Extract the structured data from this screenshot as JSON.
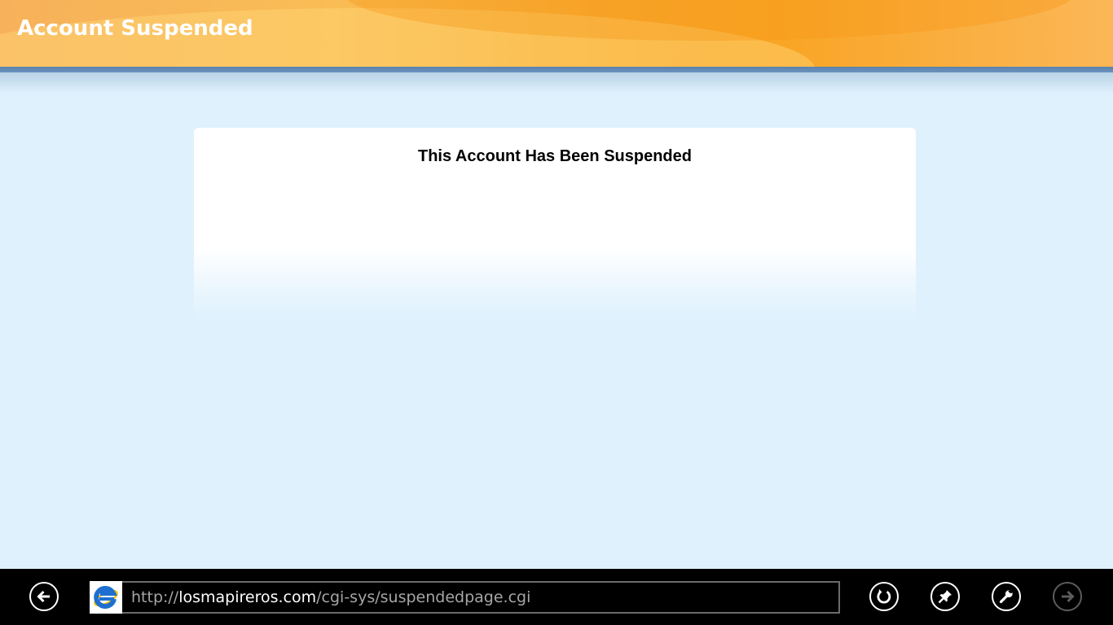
{
  "header": {
    "title": "Account Suspended"
  },
  "content": {
    "message": "This Account Has Been Suspended"
  },
  "appbar": {
    "back_icon": "arrow-left-icon",
    "site_icon": "internet-explorer-icon",
    "url": {
      "scheme": "http://",
      "domain": "losmapireros.com",
      "path": "/cgi-sys/suspendedpage.cgi"
    },
    "refresh_icon": "refresh-icon",
    "pin_icon": "pin-icon",
    "tools_icon": "wrench-icon",
    "forward_icon": "arrow-right-icon"
  },
  "colors": {
    "header_orange": "#f9a525",
    "header_bar": "#5b82ad",
    "page_background": "#dff1fd",
    "appbar_background": "#000000"
  }
}
